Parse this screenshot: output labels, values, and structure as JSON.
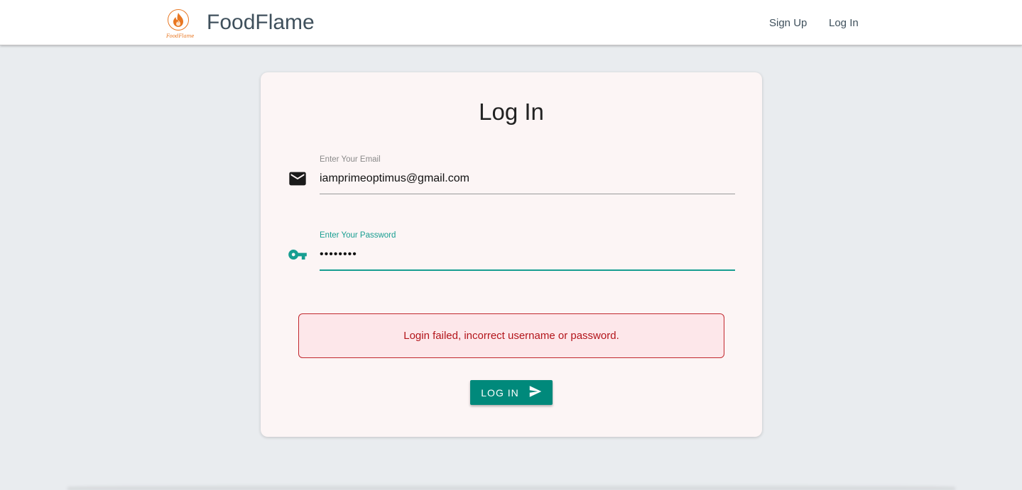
{
  "header": {
    "brand": "FoodFlame",
    "logo_caption": "FoodFlame",
    "nav": {
      "signup_label": "Sign Up",
      "login_label": "Log In"
    }
  },
  "login_form": {
    "title": "Log In",
    "email": {
      "label": "Enter Your Email",
      "value": "iamprimeoptimus@gmail.com",
      "icon": "mail-icon"
    },
    "password": {
      "label": "Enter Your Password",
      "value": "••••••••",
      "icon": "key-icon"
    },
    "error_message": "Login failed, incorrect username or password.",
    "submit_label": "LOG IN",
    "submit_icon": "send-icon"
  },
  "colors": {
    "accent": "#00897b",
    "focus": "#179e91",
    "brand_orange": "#e87722",
    "error_text": "#b3151b",
    "error_bg": "#fde7ea",
    "card_bg": "#fcf5f5",
    "page_bg": "#e9ecef"
  }
}
